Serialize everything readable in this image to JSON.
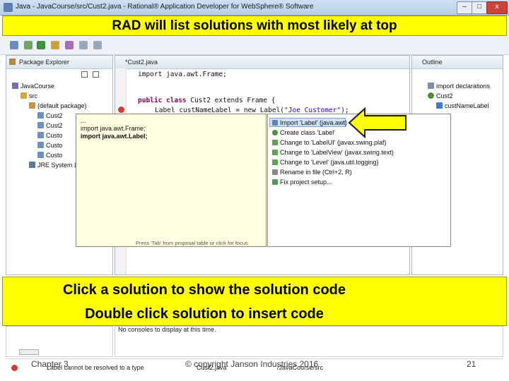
{
  "window": {
    "title": "Java - JavaCourse/src/Cust2.java - Rational® Application Developer for WebSphere® Software",
    "minimize": "–",
    "maximize": "□",
    "close": "x"
  },
  "banner_top": "RAD will list solutions with most likely at top",
  "package_explorer": {
    "tab_label": "Package Explorer",
    "tree": [
      "JavaCourse",
      "src",
      "(default package)",
      "Cust2",
      "Cust2",
      "Custo",
      "Custo",
      "Custo",
      "JRE System L"
    ]
  },
  "editor": {
    "tab_label": "*Cust2.java",
    "lines": {
      "import_line": "import java.awt.Frame;",
      "class_kw": "public class",
      "class_rest": " Cust2 extends Frame {",
      "label_decl": "Label custNameLabel = new Label(",
      "label_str": "\"Joe Customer\"",
      "label_end": ");"
    }
  },
  "proposal_preview": {
    "lines": [
      "...",
      "import java.awt.Frame;",
      "import java.awt.Label;"
    ],
    "hint": "Press 'Tab' from proposal table or click for focus"
  },
  "suggestions": [
    {
      "label": "Import 'Label' (java.awt)",
      "icon": "import-icon"
    },
    {
      "label": "Create class 'Label'",
      "icon": "class-icon"
    },
    {
      "label": "Change to 'LabelUI' (javax.swing.plaf)",
      "icon": "change-icon"
    },
    {
      "label": "Change to 'LabelView' (javax.swing.text)",
      "icon": "change-icon"
    },
    {
      "label": "Change to 'Level' (java.util.logging)",
      "icon": "change-icon"
    },
    {
      "label": "Rename in file (Ctrl+2, R)",
      "icon": "rename-icon"
    },
    {
      "label": "Fix project setup...",
      "icon": "fix-icon"
    }
  ],
  "outline": {
    "tab_label": "Outline",
    "items": [
      "import declarations",
      "Cust2",
      "custNameLabel"
    ]
  },
  "banner_bottom": {
    "line1": "Click a solution to show the solution code",
    "line2": "Double click solution to insert code"
  },
  "console": {
    "message": "No consoles to display at this time."
  },
  "problems": {
    "row": "Label cannot be resolved to a type",
    "col2": "Cust2.java",
    "col3": "/JavaCourse/src"
  },
  "footer": {
    "chapter": "Chapter 3",
    "copyright": "© copyright Janson Industries 2016",
    "page": "21"
  },
  "colors": {
    "banner": "#ffff00",
    "arrow_fill": "#ffff00",
    "popup_yellow": "#ffffe1",
    "selection": "#cfe3fb"
  }
}
